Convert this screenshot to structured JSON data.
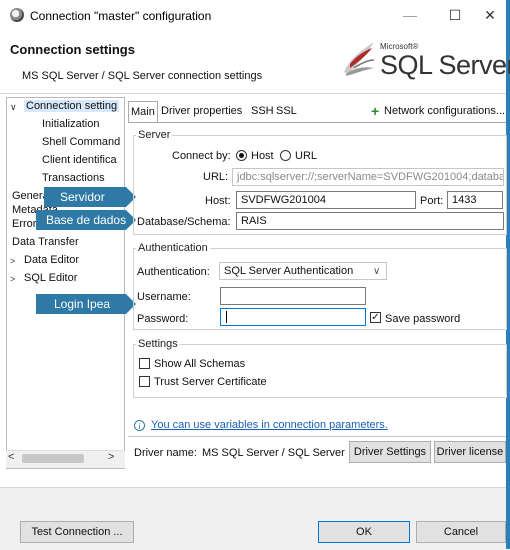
{
  "window": {
    "title": "Connection \"master\" configuration",
    "minimize_glyph": "—",
    "maximize_glyph": "☐",
    "close_glyph": "✕"
  },
  "header": {
    "title": "Connection settings",
    "subtitle": "MS SQL Server / SQL Server connection settings",
    "logo_small": "Microsoft®",
    "logo_main": "SQL Server®"
  },
  "tree": {
    "items": [
      {
        "label": "Connection setting",
        "caret": "v"
      },
      {
        "label": "Initialization"
      },
      {
        "label": "Shell Command"
      },
      {
        "label": "Client identifica"
      },
      {
        "label": "Transactions"
      },
      {
        "label": "General"
      },
      {
        "label": "Metadata"
      },
      {
        "label": "Error handle"
      },
      {
        "label": "Data Transfer"
      },
      {
        "label": "Data Editor",
        "caret": ">"
      },
      {
        "label": "SQL Editor",
        "caret": ">"
      }
    ],
    "scroll_left": "<",
    "scroll_right": ">"
  },
  "callouts": {
    "server": "Servidor",
    "database": "Base de dados",
    "login": "Login Ipea"
  },
  "tabs": {
    "items": [
      "Main",
      "Driver properties",
      "SSH",
      "SSL"
    ],
    "network": "Network configurations..."
  },
  "server_group": {
    "legend": "Server",
    "connect_by_label": "Connect by:",
    "host_option": "Host",
    "url_option": "URL",
    "url_label": "URL:",
    "url_value": "jdbc:sqlserver://;serverName=SVDFWG201004;databa",
    "host_label": "Host:",
    "host_value": "SVDFWG201004",
    "port_label": "Port:",
    "port_value": "1433",
    "db_label": "Database/Schema:",
    "db_value": "RAIS"
  },
  "auth_group": {
    "legend": "Authentication",
    "auth_label": "Authentication:",
    "auth_value": "SQL Server Authentication",
    "username_label": "Username:",
    "username_value": "",
    "password_label": "Password:",
    "password_value": "",
    "save_password": "Save password"
  },
  "settings_group": {
    "legend": "Settings",
    "show_all_schemas": "Show All Schemas",
    "trust_cert": "Trust Server Certificate"
  },
  "info": {
    "link": "You can use variables in connection parameters."
  },
  "driver": {
    "name_label": "Driver name:",
    "name_value": "MS SQL Server / SQL Server",
    "settings_button": "Driver Settings",
    "license_button": "Driver license"
  },
  "footer": {
    "test_button": "Test Connection ...",
    "ok_button": "OK",
    "cancel_button": "Cancel"
  },
  "colors": {
    "accent": "#2f79a6",
    "link": "#1a5fb4",
    "selection": "#d6e8f9"
  }
}
